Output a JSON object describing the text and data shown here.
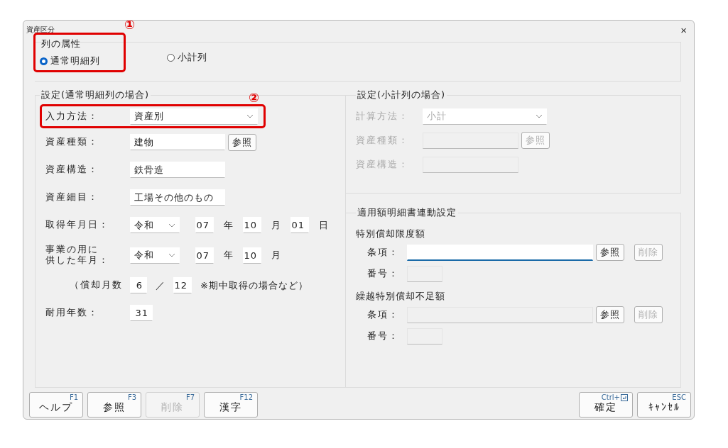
{
  "window": {
    "title": "資産区分",
    "close": "×"
  },
  "column_attribute": {
    "legend": "列の属性",
    "highlighted": true,
    "marker": "①",
    "options": [
      {
        "label": "通常明細列",
        "selected": true
      },
      {
        "label": "小計列",
        "selected": false
      }
    ]
  },
  "normal_settings": {
    "legend": "設定(通常明細列の場合)",
    "marker": "②",
    "input_method": {
      "label": "入力方法：",
      "value": "資産別",
      "highlighted": true
    },
    "asset_type": {
      "label": "資産種類：",
      "value": "建物",
      "button": "参照"
    },
    "asset_structure": {
      "label": "資産構造：",
      "value": "鉄骨造"
    },
    "asset_detail": {
      "label": "資産細目：",
      "value": "工場その他のもの"
    },
    "acquired": {
      "label": "取得年月日：",
      "era": "令和",
      "year": "07",
      "year_unit": "年",
      "month": "10",
      "month_unit": "月",
      "day": "01",
      "day_unit": "日"
    },
    "in_service": {
      "label_lines": [
        "事業の用に",
        "供した年月："
      ],
      "era": "令和",
      "year": "07",
      "year_unit": "年",
      "month": "10",
      "month_unit": "月"
    },
    "months": {
      "prefix": "（償却月数",
      "numerator": "6",
      "slash": "／",
      "denominator": "12",
      "note": "※期中取得の場合など）"
    },
    "useful_life": {
      "label": "耐用年数：",
      "value": "31"
    }
  },
  "subtotal_settings": {
    "legend": "設定(小計列の場合)",
    "disabled": true,
    "method": {
      "label": "計算方法：",
      "value": "小計"
    },
    "asset_type": {
      "label": "資産種類：",
      "button": "参照"
    },
    "asset_structure": {
      "label": "資産構造："
    }
  },
  "linked_settings": {
    "legend": "適用額明細書連動設定",
    "sections": [
      {
        "heading": "特別償却限度額",
        "clause_label": "条項：",
        "clause_focused": true,
        "ref_button": "参照",
        "delete_button": {
          "label": "削除",
          "disabled": true
        },
        "number_label": "番号："
      },
      {
        "heading": "繰越特別償却不足額",
        "clause_label": "条項：",
        "clause_focused": false,
        "ref_button": "参照",
        "delete_button": {
          "label": "削除",
          "disabled": true
        },
        "number_label": "番号："
      }
    ]
  },
  "footer_left": [
    {
      "key": "F1",
      "label": "ヘルプ",
      "disabled": false
    },
    {
      "key": "F3",
      "label": "参照",
      "disabled": false
    },
    {
      "key": "F7",
      "label": "削除",
      "disabled": true
    },
    {
      "key": "F12",
      "label": "漢字",
      "disabled": false
    }
  ],
  "footer_right": [
    {
      "key": "Ctrl+",
      "label": "確定",
      "kind": "ctrl"
    },
    {
      "key": "ESC",
      "label": "ｷｬﾝｾﾙ",
      "kind": "plain"
    }
  ]
}
